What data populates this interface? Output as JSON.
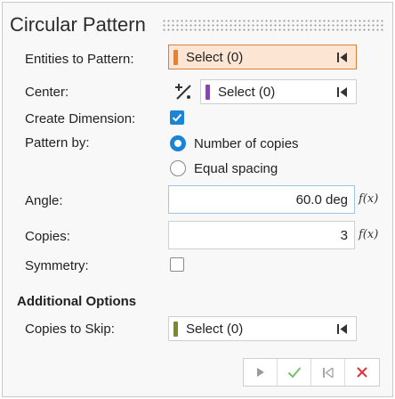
{
  "title": "Circular Pattern",
  "fields": {
    "entities": {
      "label": "Entities to Pattern:",
      "value": "Select (0)",
      "color": "#f07d26"
    },
    "center": {
      "label": "Center:",
      "value": "Select (0)",
      "color": "#8e3fbe"
    },
    "create_dimension": {
      "label": "Create Dimension:",
      "checked": true
    },
    "pattern_by": {
      "label": "Pattern by:",
      "options": [
        "Number of copies",
        "Equal spacing"
      ],
      "selected": "Number of copies"
    },
    "angle": {
      "label": "Angle:",
      "value": "60.0 deg"
    },
    "copies": {
      "label": "Copies:",
      "value": "3"
    },
    "symmetry": {
      "label": "Symmetry:",
      "checked": false
    }
  },
  "fx_label": "f(x)",
  "additional": {
    "title": "Additional Options",
    "skip": {
      "label": "Copies to Skip:",
      "value": "Select (0)",
      "color": "#7a8a2e"
    }
  },
  "icons": [
    "center-point-icon",
    "reset-selection-icon",
    "play-icon",
    "apply-check-icon",
    "prev-icon",
    "close-x-icon"
  ],
  "accent": "#1a85d6"
}
